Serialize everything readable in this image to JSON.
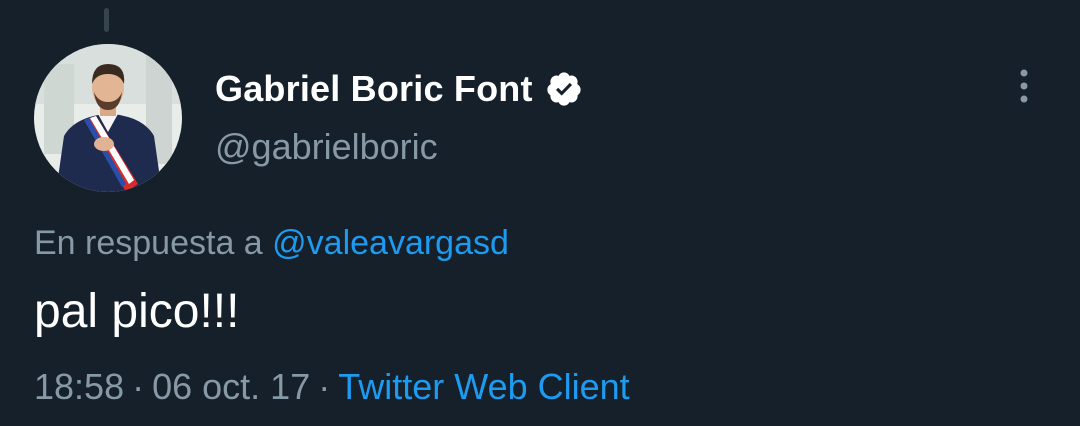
{
  "tweet": {
    "display_name": "Gabriel Boric Font",
    "handle": "@gabrielboric",
    "verified_icon": "verified-badge-icon",
    "reply_prefix": "En respuesta a",
    "reply_to": "@valeavargasd",
    "text": "pal pico!!!",
    "time": "18:58",
    "separator": "·",
    "date": "06 oct. 17",
    "source": "Twitter Web Client"
  },
  "colors": {
    "background": "#15202b",
    "primary_text": "#ffffff",
    "secondary_text": "#8899a6",
    "link": "#1d9bf0"
  },
  "icons": {
    "more": "more-vertical-icon",
    "avatar": "avatar"
  }
}
